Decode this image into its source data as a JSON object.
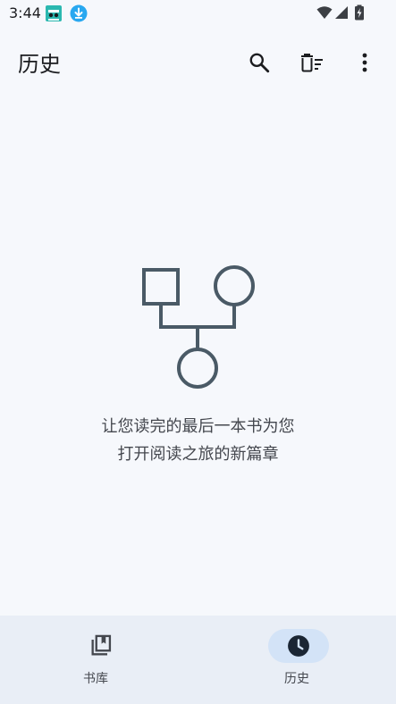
{
  "status_bar": {
    "time": "3:44",
    "icons": [
      "app-notification-icon",
      "download-icon",
      "wifi-icon",
      "signal-icon",
      "battery-icon"
    ]
  },
  "app_bar": {
    "title": "历史",
    "actions": [
      "search-icon",
      "delete-sweep-icon",
      "more-vert-icon"
    ]
  },
  "empty_state": {
    "illustration": "sitemap-icon",
    "line1": "让您读完的最后一本书为您",
    "line2": "打开阅读之旅的新篇章"
  },
  "bottom_nav": {
    "items": [
      {
        "label": "书库",
        "icon": "library-icon",
        "selected": false
      },
      {
        "label": "历史",
        "icon": "history-clock-icon",
        "selected": true
      }
    ]
  },
  "colors": {
    "background": "#f6f8fc",
    "nav_background": "#e9eef6",
    "nav_selected_pill": "#d3e3f7",
    "illustration_stroke": "#4a5a66",
    "text_primary": "#1b1c1f",
    "text_secondary": "#44474e"
  }
}
